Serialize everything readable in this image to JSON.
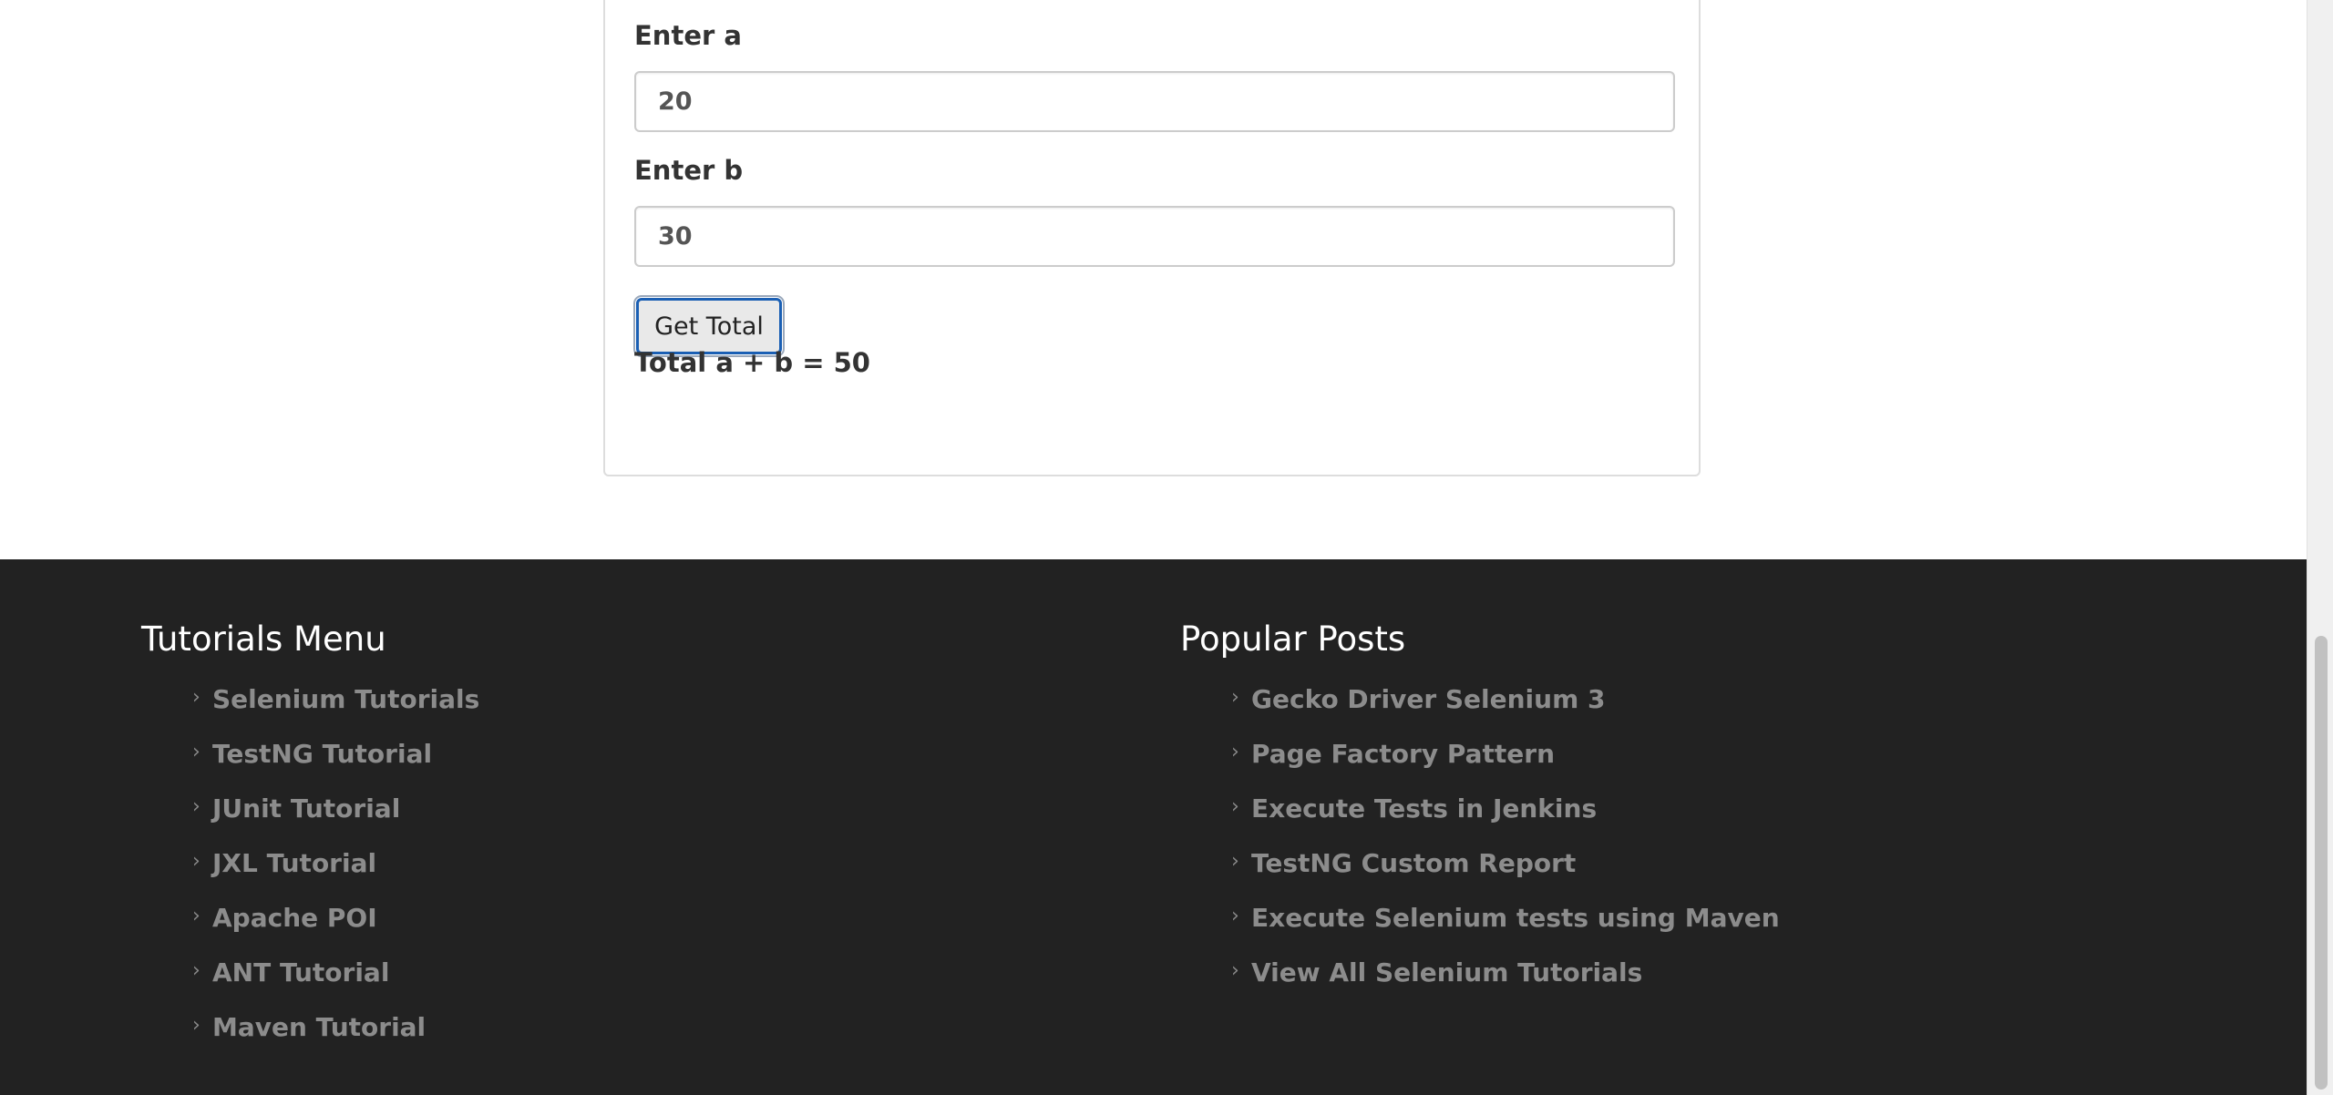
{
  "form": {
    "label_a": "Enter a",
    "value_a": "20",
    "label_b": "Enter b",
    "value_b": "30",
    "button_label": "Get Total",
    "result_text": "Total a + b = 50"
  },
  "footer": {
    "tutorials_title": "Tutorials Menu",
    "tutorials": [
      "Selenium Tutorials",
      "TestNG Tutorial",
      "JUnit Tutorial",
      "JXL Tutorial",
      "Apache POI",
      "ANT Tutorial",
      "Maven Tutorial"
    ],
    "posts_title": "Popular Posts",
    "posts": [
      "Gecko Driver Selenium 3",
      "Page Factory Pattern",
      "Execute Tests in Jenkins",
      "TestNG Custom Report",
      "Execute Selenium tests using Maven",
      "View All Selenium Tutorials"
    ]
  },
  "chevron_glyph": "›",
  "colors": {
    "footer_bg": "#222222",
    "link": "#8c8c8c",
    "button_focus": "#1a5fb4"
  }
}
